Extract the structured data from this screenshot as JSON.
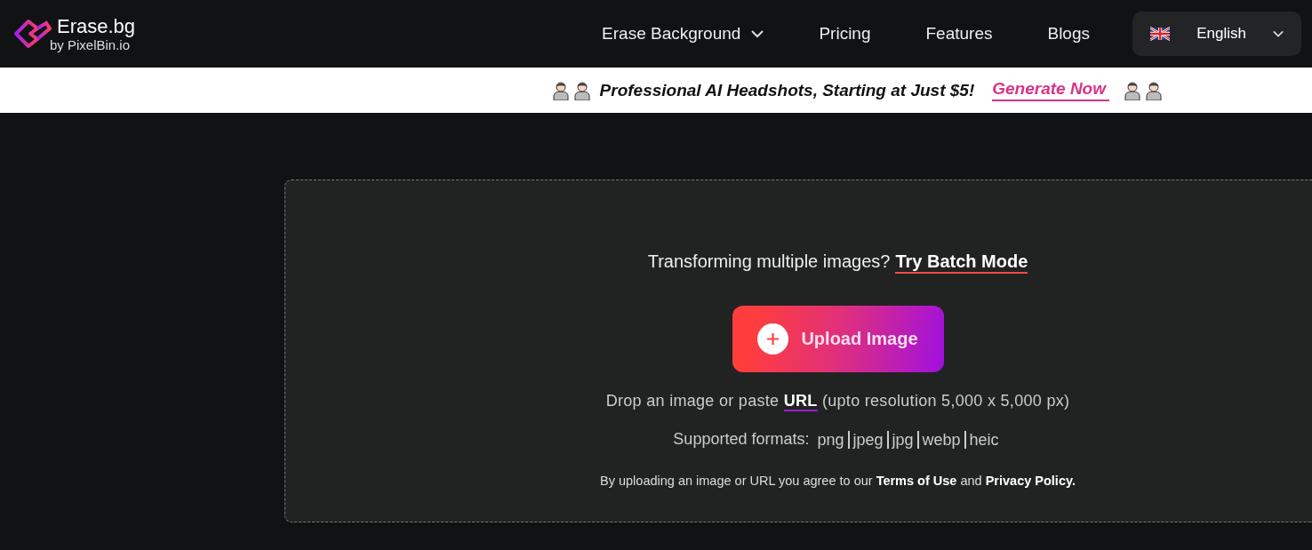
{
  "header": {
    "logo": {
      "name": "Erase.bg",
      "byline": "by PixelBin.io"
    },
    "nav": [
      {
        "label": "Erase Background",
        "dropdown": true
      },
      {
        "label": "Pricing",
        "dropdown": false
      },
      {
        "label": "Features",
        "dropdown": false
      },
      {
        "label": "Blogs",
        "dropdown": false
      }
    ],
    "language": {
      "label": "English"
    }
  },
  "banner": {
    "text": "Professional AI Headshots, Starting at Just $5!",
    "link": "Generate Now"
  },
  "upload": {
    "batch_prompt": "Transforming multiple images?",
    "batch_link": "Try Batch Mode",
    "button": "Upload Image",
    "drop_text_before": "Drop an image or paste",
    "drop_link": "URL",
    "drop_text_after": "(upto resolution 5,000 x 5,000 px)",
    "formats_label": "Supported formats:",
    "formats": [
      "png",
      "jpeg",
      "jpg",
      "webp",
      "heic"
    ],
    "legal": "By uploading an image or URL you agree to our **Terms of Use** and **Privacy Policy.**"
  }
}
